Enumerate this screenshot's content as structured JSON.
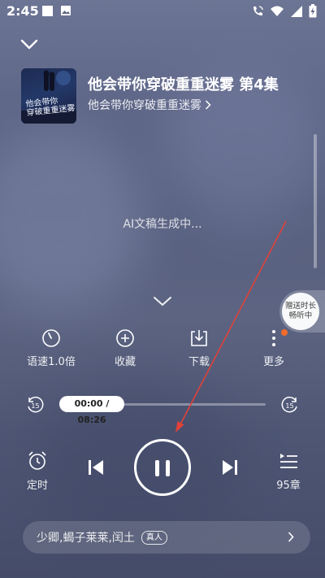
{
  "status_bar": {
    "time": "2:45"
  },
  "header": {
    "collapse_icon": "chevron-down-icon",
    "title": "他会带你穿破重重迷雾 第4集",
    "album_name": "他会带你穿破重重迷雾",
    "cover_text_line1": "他会带你",
    "cover_text_line2": "穿破重重迷雾"
  },
  "transcript": {
    "status": "AI文稿生成中..."
  },
  "promo": {
    "line1": "赠送时长",
    "line2": "畅听中"
  },
  "tools": [
    {
      "label": "语速1.0倍",
      "icon": "speed-icon"
    },
    {
      "label": "收藏",
      "icon": "plus-circle-icon"
    },
    {
      "label": "下载",
      "icon": "download-icon"
    },
    {
      "label": "更多",
      "icon": "more-icon"
    }
  ],
  "progress": {
    "current": "00:00",
    "total": "08:26",
    "display": "00:00 / 08:26",
    "fraction": 0.0
  },
  "skip": {
    "back": "15",
    "forward": "15"
  },
  "controls": {
    "timer_label": "定时",
    "episodes_label": "95章"
  },
  "cast": {
    "names": "少卿,蝎子莱莱,闰土",
    "badge": "真人"
  },
  "colors": {
    "accent_dot": "#f36b2b",
    "background": "#5c6482"
  }
}
